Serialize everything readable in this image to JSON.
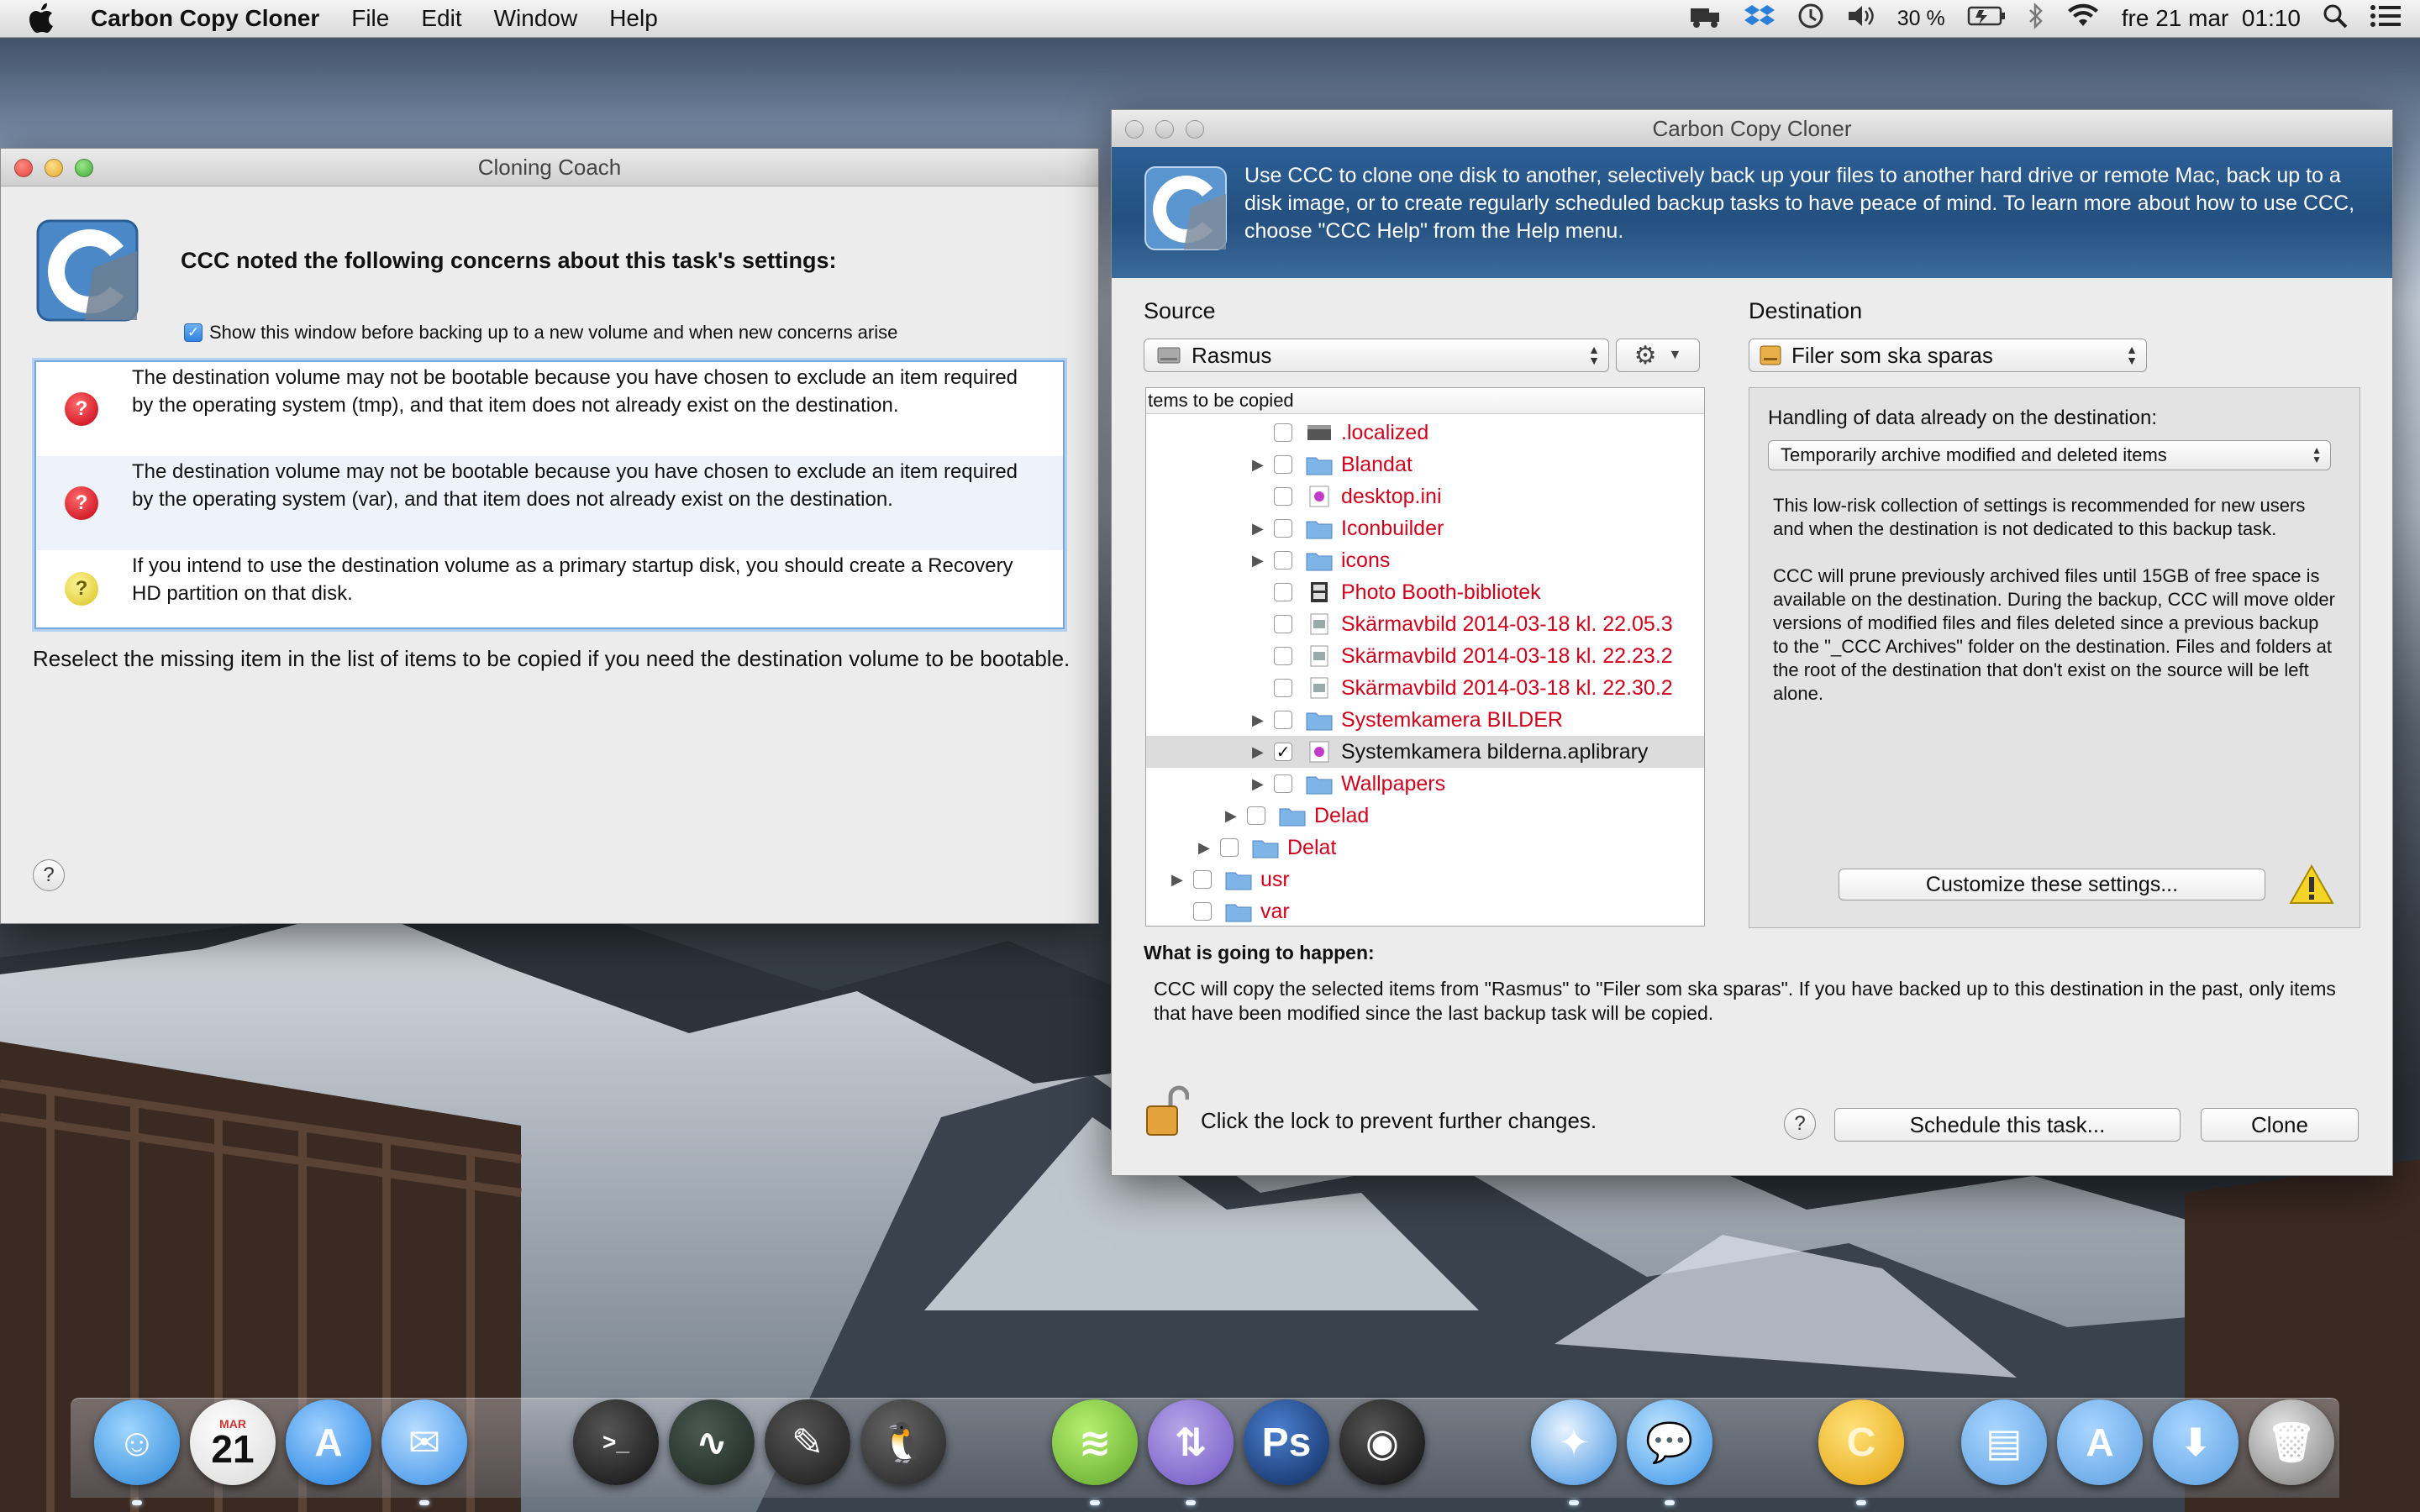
{
  "menubar": {
    "app_name": "Carbon Copy Cloner",
    "menus": [
      "File",
      "Edit",
      "Window",
      "Help"
    ],
    "battery_percent": "30 %",
    "clock": "fre 21 mar  01:10",
    "status_icons": [
      "truck-icon",
      "dropbox-icon",
      "time-machine-icon",
      "volume-icon",
      "battery-icon",
      "bluetooth-icon",
      "wifi-icon",
      "spotlight-icon",
      "notification-center-icon"
    ]
  },
  "coach": {
    "title": "Cloning Coach",
    "headline": "CCC noted the following concerns about this task's settings:",
    "show_window_label": "Show this window before backing up to a new volume and when new concerns arise",
    "show_window_checked": true,
    "concerns": [
      {
        "level": "error",
        "text": "The destination volume may not be bootable because you have chosen to exclude an item required by the operating system (tmp), and that item does not already exist on the destination."
      },
      {
        "level": "error",
        "text": "The destination volume may not be bootable because you have chosen to exclude an item required by the operating system (var), and that item does not already exist on the destination."
      },
      {
        "level": "warning",
        "text": "If you intend to use the destination volume as a primary startup disk, you should create a Recovery HD partition on that disk."
      }
    ],
    "reselect_text": "Reselect the missing item in the list of items to be copied if you need the destination volume to be bootable.",
    "help_label": "?"
  },
  "ccc": {
    "title": "Carbon Copy Cloner",
    "banner_text": "Use CCC to clone one disk to another, selectively back up your files to another hard drive or remote Mac, back up to a disk image, or to create regularly scheduled backup tasks to have peace of mind. To learn more about how to use CCC, choose \"CCC Help\" from the Help menu.",
    "source_label": "Source",
    "source_value": "Rasmus",
    "destination_label": "Destination",
    "destination_value": "Filer som ska sparas",
    "items_header": "tems to be copied",
    "items": [
      {
        "name": ".localized",
        "checked": false,
        "disclosure": false
      },
      {
        "name": "Blandat",
        "checked": false,
        "disclosure": true
      },
      {
        "name": "desktop.ini",
        "checked": false,
        "disclosure": false
      },
      {
        "name": "Iconbuilder",
        "checked": false,
        "disclosure": true
      },
      {
        "name": "icons",
        "checked": false,
        "disclosure": true
      },
      {
        "name": "Photo Booth-bibliotek",
        "checked": false,
        "disclosure": false
      },
      {
        "name": "Skärmavbild 2014-03-18 kl. 22.05.3",
        "checked": false,
        "disclosure": false
      },
      {
        "name": "Skärmavbild 2014-03-18 kl. 22.23.2",
        "checked": false,
        "disclosure": false
      },
      {
        "name": "Skärmavbild 2014-03-18 kl. 22.30.2",
        "checked": false,
        "disclosure": false
      },
      {
        "name": "Systemkamera BILDER",
        "checked": false,
        "disclosure": true
      },
      {
        "name": "Systemkamera bilderna.aplibrary",
        "checked": true,
        "disclosure": true
      },
      {
        "name": "Wallpapers",
        "checked": false,
        "disclosure": true
      },
      {
        "name": "Delad",
        "checked": false,
        "disclosure": true
      },
      {
        "name": "Delat",
        "checked": false,
        "disclosure": true
      },
      {
        "name": "usr",
        "checked": false,
        "disclosure": true
      },
      {
        "name": "var",
        "checked": false,
        "disclosure": false
      }
    ],
    "handling_label": "Handling of data already on the destination:",
    "handling_value": "Temporarily archive modified and deleted items",
    "handling_desc_1": "This low-risk collection of settings is recommended for new users and when the destination is not dedicated to this backup task.",
    "handling_desc_2": "CCC will prune previously archived files until 15GB of free space is available on the destination. During the backup, CCC will move older versions of modified files and files deleted since a previous backup to the \"_CCC Archives\" folder on the destination. Files and folders at the root of the destination that don't exist on the source will be left alone.",
    "customize_label": "Customize these settings...",
    "what_label": "What is going to happen:",
    "what_text": "CCC will copy the selected items from \"Rasmus\" to \"Filer som ska sparas\". If you have backed up to this destination in the past, only items that have been modified since the last backup task will be copied.",
    "lock_text": "Click the lock to prevent further changes.",
    "help_label": "?",
    "schedule_label": "Schedule this task...",
    "clone_label": "Clone"
  },
  "dock": {
    "calendar_month": "MAR",
    "calendar_day": "21",
    "terminal_prompt": ">_",
    "photoshop_label": "Ps",
    "ccc_label": "C",
    "apps": [
      "finder-icon",
      "calendar-icon",
      "app-store-icon",
      "mail-icon",
      "terminal-icon",
      "activity-monitor-icon",
      "script-editor-icon",
      "linux-tux-icon",
      "spotify-icon",
      "migration-icon",
      "photoshop-icon",
      "aperture-icon",
      "safari-icon",
      "messages-icon",
      "carbon-copy-cloner-icon",
      "video-folder-icon",
      "applications-folder-icon",
      "downloads-folder-icon",
      "trash-icon"
    ]
  },
  "colors": {
    "excluded_item": "#d0021b",
    "banner": "#2d5f96",
    "error_icon": "#d0021b",
    "warning_icon": "#e8d230"
  }
}
